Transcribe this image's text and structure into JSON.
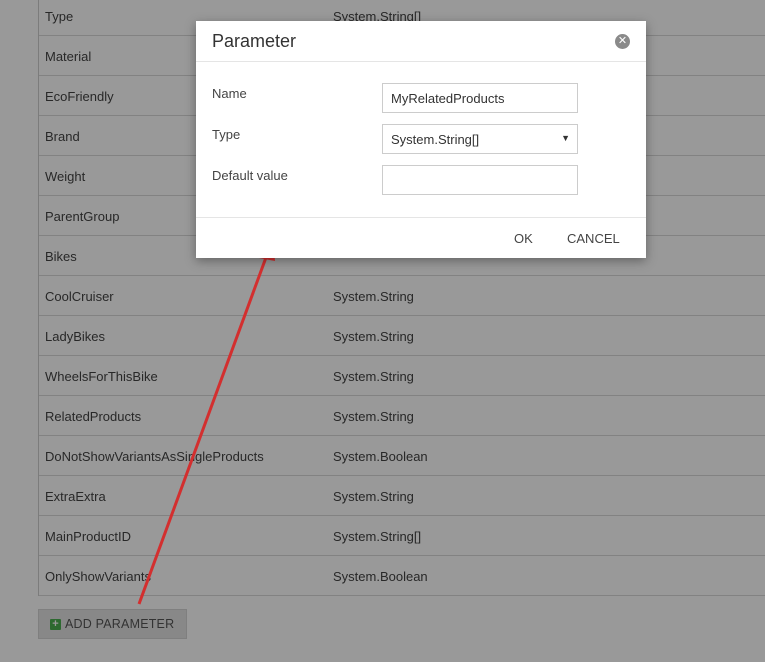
{
  "parameters": [
    {
      "name": "Type",
      "type": "System.String[]"
    },
    {
      "name": "Material",
      "type": ""
    },
    {
      "name": "EcoFriendly",
      "type": ""
    },
    {
      "name": "Brand",
      "type": ""
    },
    {
      "name": "Weight",
      "type": ""
    },
    {
      "name": "ParentGroup",
      "type": ""
    },
    {
      "name": "Bikes",
      "type": ""
    },
    {
      "name": "CoolCruiser",
      "type": "System.String"
    },
    {
      "name": "LadyBikes",
      "type": "System.String"
    },
    {
      "name": "WheelsForThisBike",
      "type": "System.String"
    },
    {
      "name": "RelatedProducts",
      "type": "System.String"
    },
    {
      "name": "DoNotShowVariantsAsSingleProducts",
      "type": "System.Boolean"
    },
    {
      "name": "ExtraExtra",
      "type": "System.String"
    },
    {
      "name": "MainProductID",
      "type": "System.String[]"
    },
    {
      "name": "OnlyShowVariants",
      "type": "System.Boolean"
    }
  ],
  "add_parameter_label": "ADD PARAMETER",
  "dialog": {
    "title": "Parameter",
    "name_label": "Name",
    "name_value": "MyRelatedProducts",
    "type_label": "Type",
    "type_value": "System.String[]",
    "default_label": "Default value",
    "default_value": "",
    "ok_label": "OK",
    "cancel_label": "CANCEL"
  },
  "colors": {
    "overlay": "rgba(0,0,0,0.40)",
    "annotation_arrow": "#d32f2f",
    "add_icon": "#4caf50"
  },
  "icons": {
    "close": "close-circle-icon",
    "add": "plus-square-icon",
    "select": "caret-down-icon"
  }
}
